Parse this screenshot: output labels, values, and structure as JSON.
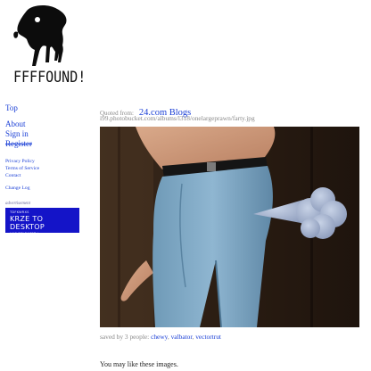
{
  "logo": {
    "text": "FFFFOUND!"
  },
  "nav": {
    "top": "Top",
    "about": "About",
    "sign_in": "Sign in",
    "register": "Register",
    "privacy": "Privacy Policy",
    "terms": "Terms of Service",
    "contact": "Contact",
    "change_log": "Change Log"
  },
  "ad": {
    "label": "advertisement",
    "line1": "TDFKWRXS",
    "title": "KRZE TO DESKTOP",
    "line3": "HAS RELEASED !"
  },
  "post": {
    "quoted_label": "Quoted from:",
    "source": "24.com Blogs",
    "url": "i99.photobucket.com/albums/l318/onelargeprawn/farty.jpg",
    "saved_prefix": "saved by 3 people:",
    "savers": [
      "chewy",
      "valbator",
      "vectortrut"
    ],
    "saved_sep": ", "
  },
  "may_like": "You may like these images.",
  "colors": {
    "link": "#1a3fd6",
    "muted": "#8a8a8a",
    "ad_background": "#1414c8",
    "jeans": "#7fa8c4",
    "cloud": "#a9b6cf"
  }
}
